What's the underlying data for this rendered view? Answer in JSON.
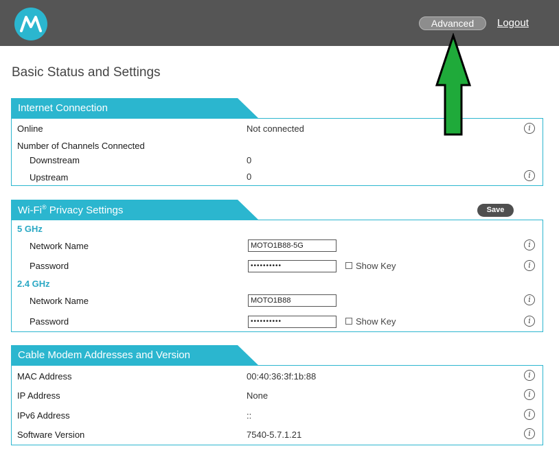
{
  "header": {
    "logo_icon": "motorola-logo",
    "advanced_label": "Advanced",
    "logout_label": "Logout"
  },
  "page": {
    "title": "Basic Status and Settings"
  },
  "internet": {
    "title": "Internet Connection",
    "online_label": "Online",
    "online_value": "Not connected",
    "channels_label": "Number of Channels Connected",
    "downstream_label": "Downstream",
    "downstream_value": "0",
    "upstream_label": "Upstream",
    "upstream_value": "0"
  },
  "wifi": {
    "title": "Wi-Fi",
    "title_sup": "®",
    "title_rest": " Privacy Settings",
    "save_label": "Save",
    "band_5": "5 GHz",
    "band_24": "2.4 GHz",
    "network_name_label": "Network Name",
    "password_label": "Password",
    "ssid_5": "MOTO1B88-5G",
    "pwd_5": "••••••••••",
    "ssid_24": "MOTO1B88",
    "pwd_24": "••••••••••",
    "show_key_label": "Show Key"
  },
  "cable": {
    "title": "Cable Modem Addresses and Version",
    "mac_label": "MAC Address",
    "mac_value": "00:40:36:3f:1b:88",
    "ip_label": "IP Address",
    "ip_value": "None",
    "ipv6_label": "IPv6 Address",
    "ipv6_value": "::",
    "sw_label": "Software Version",
    "sw_value": "7540-5.7.1.21"
  },
  "colors": {
    "accent": "#2bb6cf",
    "topbar": "#555555",
    "arrow": "#1faa3a"
  }
}
